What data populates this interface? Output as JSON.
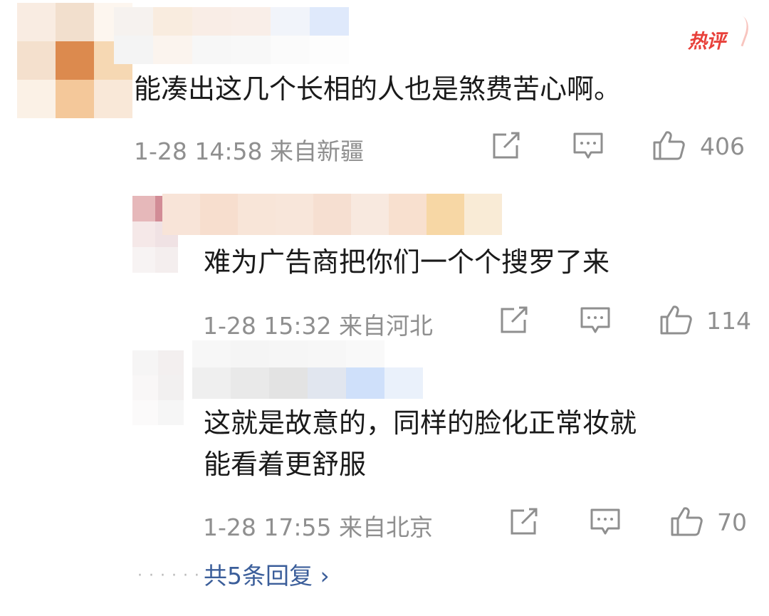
{
  "badge": {
    "hot_label": "热评"
  },
  "comments": [
    {
      "text": "能凑出这几个长相的人也是煞费苦心啊。",
      "time": "1-28 14:58",
      "location": "来自新疆",
      "likes": "406"
    }
  ],
  "replies": [
    {
      "text": "难为广告商把你们一个个搜罗了来",
      "time": "1-28 15:32",
      "location": "来自河北",
      "likes": "114"
    },
    {
      "text_line1": "这就是故意的，同样的脸化正常妆就",
      "text_line2": "能看着更舒服",
      "time": "1-28 17:55",
      "location": "来自北京",
      "likes": "70"
    }
  ],
  "more_replies": {
    "label": "共5条回复 ›"
  },
  "icons": {
    "share": "share-icon",
    "comment": "comment-icon",
    "like": "like-icon"
  },
  "colors": {
    "meta_text": "#8f8f8f",
    "link": "#3b5e9a",
    "hot": "#e8403a"
  }
}
